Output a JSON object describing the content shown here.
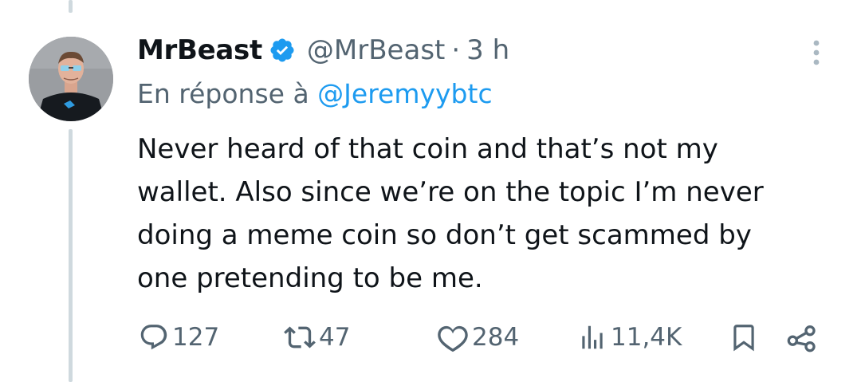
{
  "tweet": {
    "author_name": "MrBeast",
    "author_handle": "@MrBeast",
    "separator": "·",
    "time": "3 h",
    "verified": true,
    "reply_prefix": "En réponse à",
    "reply_mention": "@Jeremyybtc",
    "text_lines": [
      "Never heard of that coin and that’s not my",
      "wallet. Also since we’re on the topic I’m never",
      "doing a meme coin so don’t get scammed by",
      "one pretending to be me."
    ]
  },
  "actions": {
    "replies": "127",
    "retweets": "47",
    "likes": "284",
    "views": "11,4K"
  },
  "icons": {
    "verified": "verified-badge-icon",
    "more": "more-vertical-icon",
    "reply": "reply-icon",
    "retweet": "retweet-icon",
    "like": "heart-icon",
    "views": "views-chart-icon",
    "bookmark": "bookmark-icon",
    "share": "share-icon"
  },
  "colors": {
    "text": "#0f1419",
    "secondary": "#536471",
    "link": "#1d9bf0",
    "thread_line": "#cfd9de"
  }
}
